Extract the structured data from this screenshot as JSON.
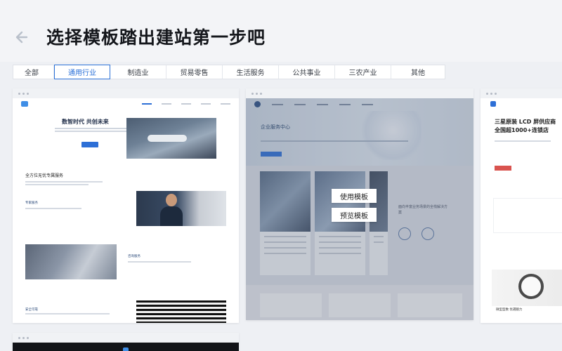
{
  "header": {
    "title": "选择模板踏出建站第一步吧"
  },
  "tabs": [
    {
      "label": "全部"
    },
    {
      "label": "通用行业"
    },
    {
      "label": "制造业"
    },
    {
      "label": "贸易零售"
    },
    {
      "label": "生活服务"
    },
    {
      "label": "公共事业"
    },
    {
      "label": "三农产业"
    },
    {
      "label": "其他"
    }
  ],
  "active_tab": "通用行业",
  "colors": {
    "accent": "#2b71d8",
    "background": "#eef0f4"
  },
  "card1": {
    "hero_title": "数智时代 共创未来",
    "section_title": "全方位无忧专属服务",
    "labels": [
      "专家服务",
      "咨询服务",
      "安全可靠"
    ]
  },
  "card2": {
    "hero_title": "企业服务中心",
    "side_text": "面向丰富业务场景的全栈解决方案",
    "overlay": {
      "use_label": "使用模板",
      "preview_label": "预览模板"
    }
  },
  "card3": {
    "title_line1": "三星原装 LCD 屏供应商",
    "title_line2": "全国超1000+连锁店",
    "caption": "微型型数 优選魅力"
  },
  "icons": {
    "back": "arrow-left-icon"
  }
}
